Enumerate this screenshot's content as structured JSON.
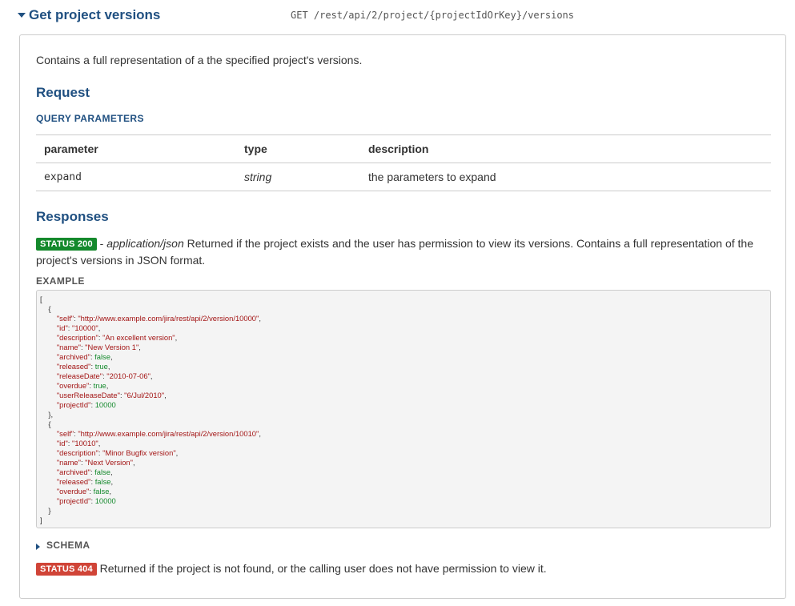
{
  "method": {
    "title": "Get project versions",
    "path": "GET /rest/api/2/project/{projectIdOrKey}/versions",
    "description": "Contains a full representation of a the specified project's versions."
  },
  "request": {
    "heading": "Request",
    "query_heading": "QUERY PARAMETERS",
    "table": {
      "headers": [
        "parameter",
        "type",
        "description"
      ],
      "rows": [
        {
          "parameter": "expand",
          "type": "string",
          "description": "the parameters to expand"
        }
      ]
    }
  },
  "responses": {
    "heading": "Responses",
    "status200": {
      "badge": "STATUS 200",
      "content_type": "application/json",
      "text": "Returned if the project exists and the user has permission to view its versions. Contains a full representation of the project's versions in JSON format."
    },
    "example_heading": "EXAMPLE",
    "example_versions": [
      {
        "self": "http://www.example.com/jira/rest/api/2/version/10000",
        "id": "10000",
        "description": "An excellent version",
        "name": "New Version 1",
        "archived": "false",
        "released": "true",
        "releaseDate": "2010-07-06",
        "overdue": "true",
        "userReleaseDate": "6/Jul/2010",
        "projectId": "10000"
      },
      {
        "self": "http://www.example.com/jira/rest/api/2/version/10010",
        "id": "10010",
        "description": "Minor Bugfix version",
        "name": "Next Version",
        "archived": "false",
        "released": "false",
        "overdue": "false",
        "projectId": "10000"
      }
    ],
    "schema_label": "SCHEMA",
    "status404": {
      "badge": "STATUS 404",
      "text": "Returned if the project is not found, or the calling user does not have permission to view it."
    }
  },
  "colors": {
    "heading": "#205081",
    "status_ok": "#14892c",
    "status_error": "#d04437",
    "json_key_string": "#a31515",
    "json_literal": "#14892c"
  }
}
